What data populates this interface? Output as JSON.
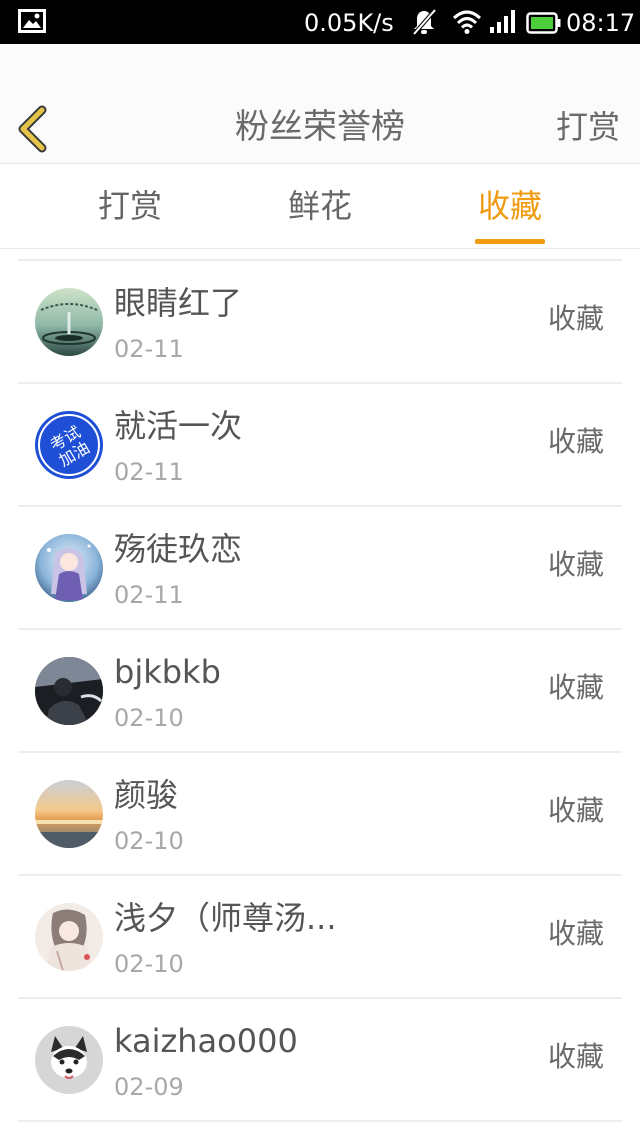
{
  "status_bar": {
    "speed": "0.05K/s",
    "time": "08:17",
    "icons": [
      "image-notification-icon",
      "mute-icon",
      "wifi-icon",
      "signal-icon",
      "battery-icon"
    ]
  },
  "header": {
    "title": "粉丝荣誉榜",
    "action": "打赏",
    "back_icon": "chevron-left-icon"
  },
  "tabs": [
    {
      "label": "打赏",
      "active": false
    },
    {
      "label": "鲜花",
      "active": false
    },
    {
      "label": "收藏",
      "active": true
    }
  ],
  "colors": {
    "accent": "#f09b11",
    "title": "#6a6a6a",
    "text": "#555555",
    "muted": "#a8a8a8",
    "back_icon": "#e6c44a"
  },
  "list": [
    {
      "name": "眼睛红了",
      "date": "02-11",
      "action": "收藏",
      "avatar": "water-drop-avatar"
    },
    {
      "name": "就活一次",
      "date": "02-11",
      "action": "收藏",
      "avatar": "exam-badge-avatar",
      "avatar_text": [
        "考试",
        "加油"
      ]
    },
    {
      "name": "殇徒玖恋",
      "date": "02-11",
      "action": "收藏",
      "avatar": "anime-character-avatar"
    },
    {
      "name": "bjkbkb",
      "date": "02-10",
      "action": "收藏",
      "avatar": "driver-silhouette-avatar"
    },
    {
      "name": "颜骏",
      "date": "02-10",
      "action": "收藏",
      "avatar": "sunset-sea-avatar"
    },
    {
      "name": "浅夕（师尊汤...",
      "date": "02-10",
      "action": "收藏",
      "avatar": "ink-painting-avatar"
    },
    {
      "name": "kaizhao000",
      "date": "02-09",
      "action": "收藏",
      "avatar": "husky-dog-avatar"
    }
  ]
}
